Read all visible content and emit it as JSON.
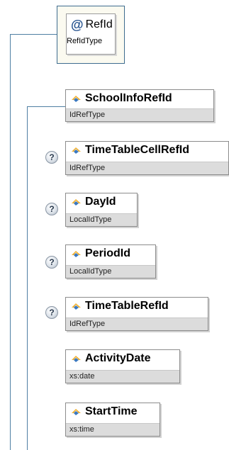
{
  "attribute": {
    "symbol": "@",
    "name": "RefId",
    "type": "RefIdType"
  },
  "elements": [
    {
      "name": "SchoolInfoRefId",
      "type": "IdRefType",
      "optional": false
    },
    {
      "name": "TimeTableCellRefId",
      "type": "IdRefType",
      "optional": true
    },
    {
      "name": "DayId",
      "type": "LocalIdType",
      "optional": true
    },
    {
      "name": "PeriodId",
      "type": "LocalIdType",
      "optional": true
    },
    {
      "name": "TimeTableRefId",
      "type": "IdRefType",
      "optional": true
    },
    {
      "name": "ActivityDate",
      "type": "xs:date",
      "optional": false
    },
    {
      "name": "StartTime",
      "type": "xs:time",
      "optional": false
    }
  ],
  "optional_marker": "?",
  "colors": {
    "connector": "#4f7fa3",
    "attribute_border": "#3e6c8f",
    "type_band": "#dcdcdc"
  }
}
